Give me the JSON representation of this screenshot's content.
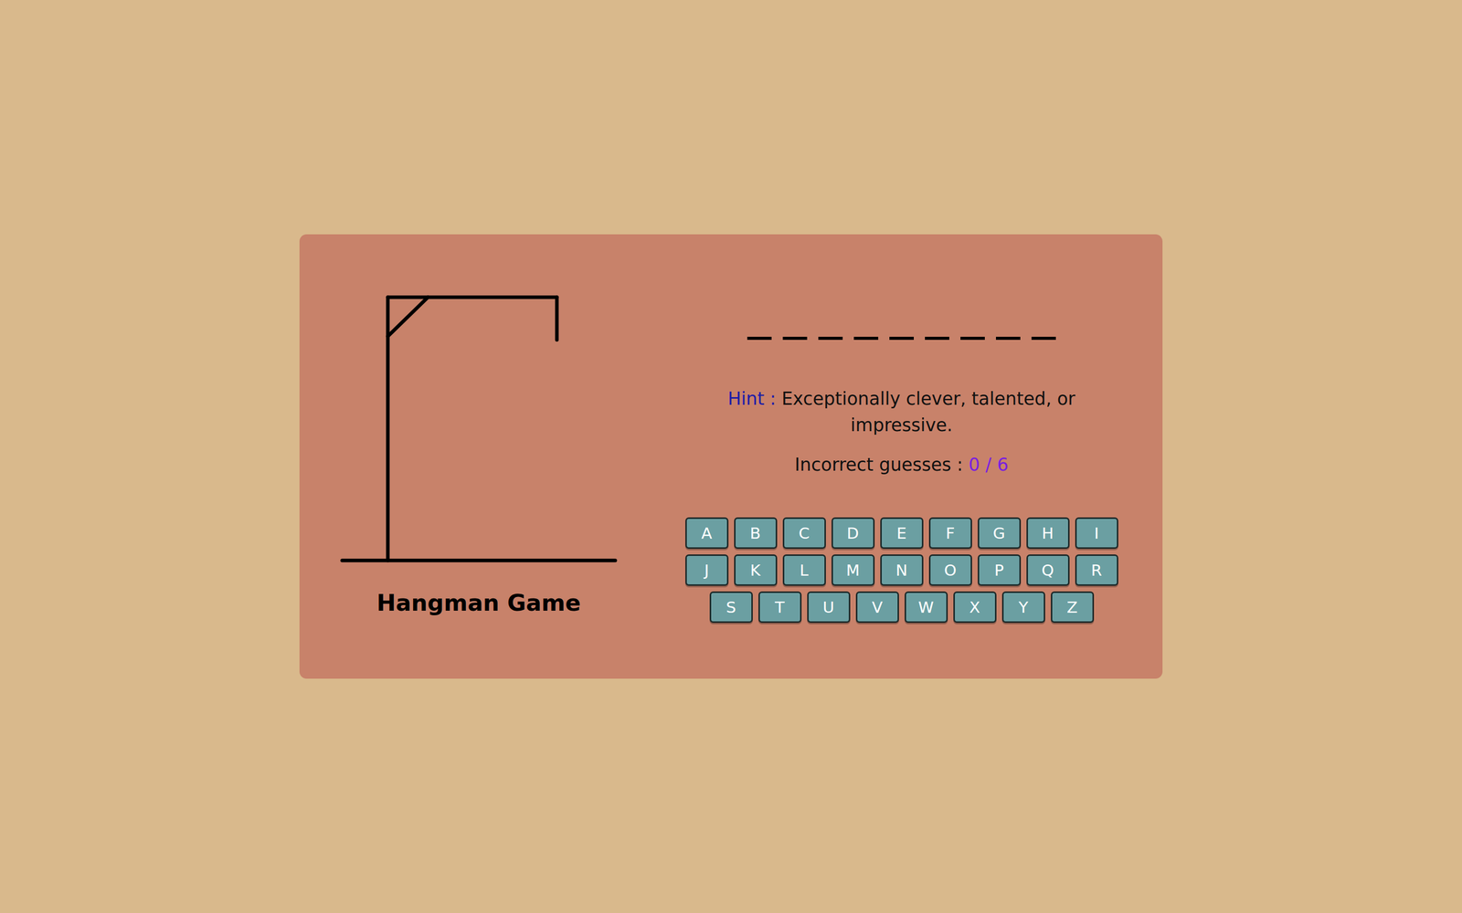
{
  "game": {
    "title": "Hangman Game"
  },
  "hangman": {
    "parts_shown": 0,
    "parts_total": 6
  },
  "word": {
    "slots": [
      {
        "letter": "",
        "revealed": false
      },
      {
        "letter": "",
        "revealed": false
      },
      {
        "letter": "",
        "revealed": false
      },
      {
        "letter": "",
        "revealed": false
      },
      {
        "letter": "",
        "revealed": false
      },
      {
        "letter": "",
        "revealed": false
      },
      {
        "letter": "",
        "revealed": false
      },
      {
        "letter": "",
        "revealed": false
      },
      {
        "letter": "",
        "revealed": false
      }
    ]
  },
  "hint": {
    "label": "Hint :",
    "text": "Exceptionally clever, talented, or impressive."
  },
  "guesses": {
    "label": "Incorrect guesses :",
    "count": "0 / 6"
  },
  "keyboard": {
    "rows": [
      [
        {
          "key": "A",
          "disabled": false
        },
        {
          "key": "B",
          "disabled": false
        },
        {
          "key": "C",
          "disabled": false
        },
        {
          "key": "D",
          "disabled": false
        },
        {
          "key": "E",
          "disabled": false
        },
        {
          "key": "F",
          "disabled": false
        },
        {
          "key": "G",
          "disabled": false
        },
        {
          "key": "H",
          "disabled": false
        },
        {
          "key": "I",
          "disabled": false
        }
      ],
      [
        {
          "key": "J",
          "disabled": false
        },
        {
          "key": "K",
          "disabled": false
        },
        {
          "key": "L",
          "disabled": false
        },
        {
          "key": "M",
          "disabled": false
        },
        {
          "key": "N",
          "disabled": false
        },
        {
          "key": "O",
          "disabled": false
        },
        {
          "key": "P",
          "disabled": false
        },
        {
          "key": "Q",
          "disabled": false
        },
        {
          "key": "R",
          "disabled": false
        }
      ],
      [
        {
          "key": "S",
          "disabled": false
        },
        {
          "key": "T",
          "disabled": false
        },
        {
          "key": "U",
          "disabled": false
        },
        {
          "key": "V",
          "disabled": false
        },
        {
          "key": "W",
          "disabled": false
        },
        {
          "key": "X",
          "disabled": false
        },
        {
          "key": "Y",
          "disabled": false
        },
        {
          "key": "Z",
          "disabled": false
        }
      ]
    ]
  }
}
